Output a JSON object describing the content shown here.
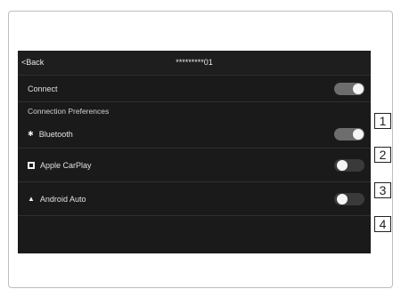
{
  "header": {
    "back_label": "<Back",
    "title": "*********01"
  },
  "rows": [
    {
      "label": "Connect",
      "toggle": "on",
      "callout": "1"
    },
    {
      "label": "Bluetooth",
      "icon": "bluetooth-icon",
      "toggle": "on",
      "callout": "2"
    },
    {
      "label": "Apple CarPlay",
      "icon": "carplay-icon",
      "toggle": "off",
      "callout": "3"
    },
    {
      "label": "Android Auto",
      "icon": "android-auto-icon",
      "toggle": "off",
      "callout": "4"
    }
  ],
  "section": {
    "label": "Connection Preferences"
  },
  "colors": {
    "screen_bg": "#1a1a1a",
    "toggle_on": "#6d6d6d",
    "toggle_off": "#3a3a3a",
    "knob": "#f5f5f5"
  }
}
